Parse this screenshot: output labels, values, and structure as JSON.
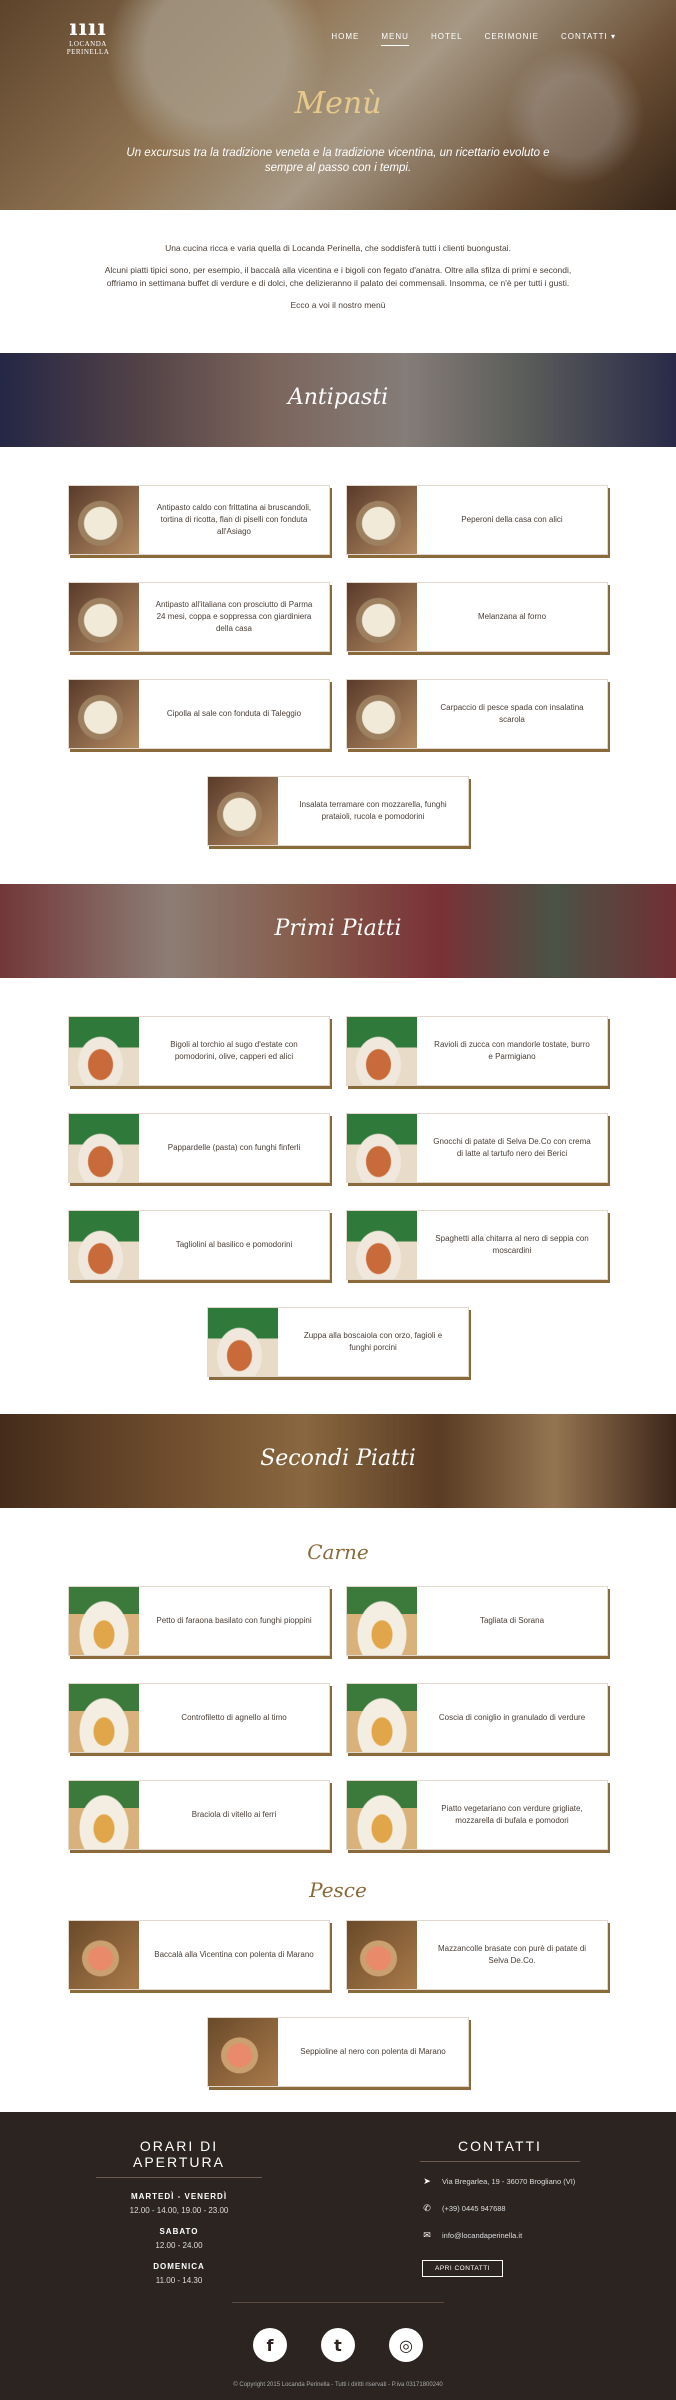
{
  "brand": {
    "mark": "ıııı",
    "name_line1": "LOCANDA",
    "name_line2": "PERINELLA"
  },
  "nav": [
    {
      "label": "HOME",
      "active": false
    },
    {
      "label": "MENU",
      "active": true
    },
    {
      "label": "HOTEL",
      "active": false
    },
    {
      "label": "CERIMONIE",
      "active": false
    },
    {
      "label": "CONTATTI ▾",
      "active": false
    }
  ],
  "hero": {
    "title": "Menù",
    "subtitle": "Un excursus tra la tradizione veneta e la tradizione vicentina, un ricettario evoluto e sempre al passo con i tempi."
  },
  "intro": {
    "p1": "Una cucina ricca e varia quella di Locanda Perinella, che soddisferà tutti i clienti buongustai.",
    "p2": "Alcuni piatti tipici sono, per esempio, il baccalà alla vicentina e i bigoli con fegato d'anatra. Oltre alla sfilza di primi e secondi, offriamo in settimana buffet di verdure e di dolci, che delizieranno il palato dei commensali. Insomma, ce n'è per tutti i gusti.",
    "p3": "Ecco a voi il nostro menù"
  },
  "sections": {
    "antipasti": {
      "title": "Antipasti",
      "items": [
        "Antipasto caldo con frittatina ai bruscandoli, tortina di ricotta, flan di piselli con fonduta all'Asiago",
        "Peperoni della casa con alici",
        "Antipasto all'italiana con prosciutto di Parma 24 mesi, coppa e soppressa con giardiniera della casa",
        "Melanzana al forno",
        "Cipolla al sale con fonduta di Taleggio",
        "Carpaccio di pesce spada con insalatina scarola",
        "Insalata terramare con mozzarella, funghi prataioli, rucola e pomodorini"
      ]
    },
    "primi": {
      "title": "Primi Piatti",
      "items": [
        "Bigoli al torchio al sugo d'estate con pomodorini, olive, capperi ed alici",
        "Ravioli di zucca con mandorle tostate, burro e Parmigiano",
        "Pappardelle (pasta) con funghi finferli",
        "Gnocchi di patate di Selva De.Co con crema di latte al tartufo nero dei Berici",
        "Tagliolini al basilico e pomodorini",
        "Spaghetti alla chitarra al nero di seppia con moscardini",
        "Zuppa alla boscaiola con orzo, fagioli e funghi porcini"
      ]
    },
    "secondi": {
      "title": "Secondi Piatti",
      "carne_title": "Carne",
      "carne": [
        "Petto di faraona basilato con funghi pioppini",
        "Tagliata di Sorana",
        "Controfiletto di agnello al timo",
        "Coscia di coniglio in granulado di verdure",
        "Braciola di vitello ai ferri",
        "Piatto vegetariano con verdure grigliate, mozzarella di bufala e pomodori"
      ],
      "pesce_title": "Pesce",
      "pesce": [
        "Baccalà alla Vicentina con polenta di Marano",
        "Mazzancolle brasate con purè di patate di Selva De.Co.",
        "Seppioline al nero con polenta di Marano"
      ]
    }
  },
  "footer": {
    "hours_title": "ORARI DI APERTURA",
    "hours": [
      {
        "day": "MARTEDÌ - VENERDÌ",
        "time": "12.00 - 14.00, 19.00 - 23.00"
      },
      {
        "day": "SABATO",
        "time": "12.00 - 24.00"
      },
      {
        "day": "DOMENICA",
        "time": "11.00 - 14.30"
      }
    ],
    "contact_title": "CONTATTI",
    "address": "Via Bregarlea, 19 - 36070 Brogliano (VI)",
    "phone": "(+39) 0445 947688",
    "email": "info@locandaperinella.it",
    "contact_button": "APRI CONTATTI",
    "social_icons": [
      "facebook-icon",
      "twitter-icon",
      "tripadvisor-icon"
    ],
    "copyright": "© Copyright 2015 Locanda Perinella - Tutti i diritti riservati - P.iva 03171800240"
  },
  "colors": {
    "accent": "#8a6a3a",
    "footer_bg": "#2b2421",
    "hero_title": "#e7c98a"
  }
}
